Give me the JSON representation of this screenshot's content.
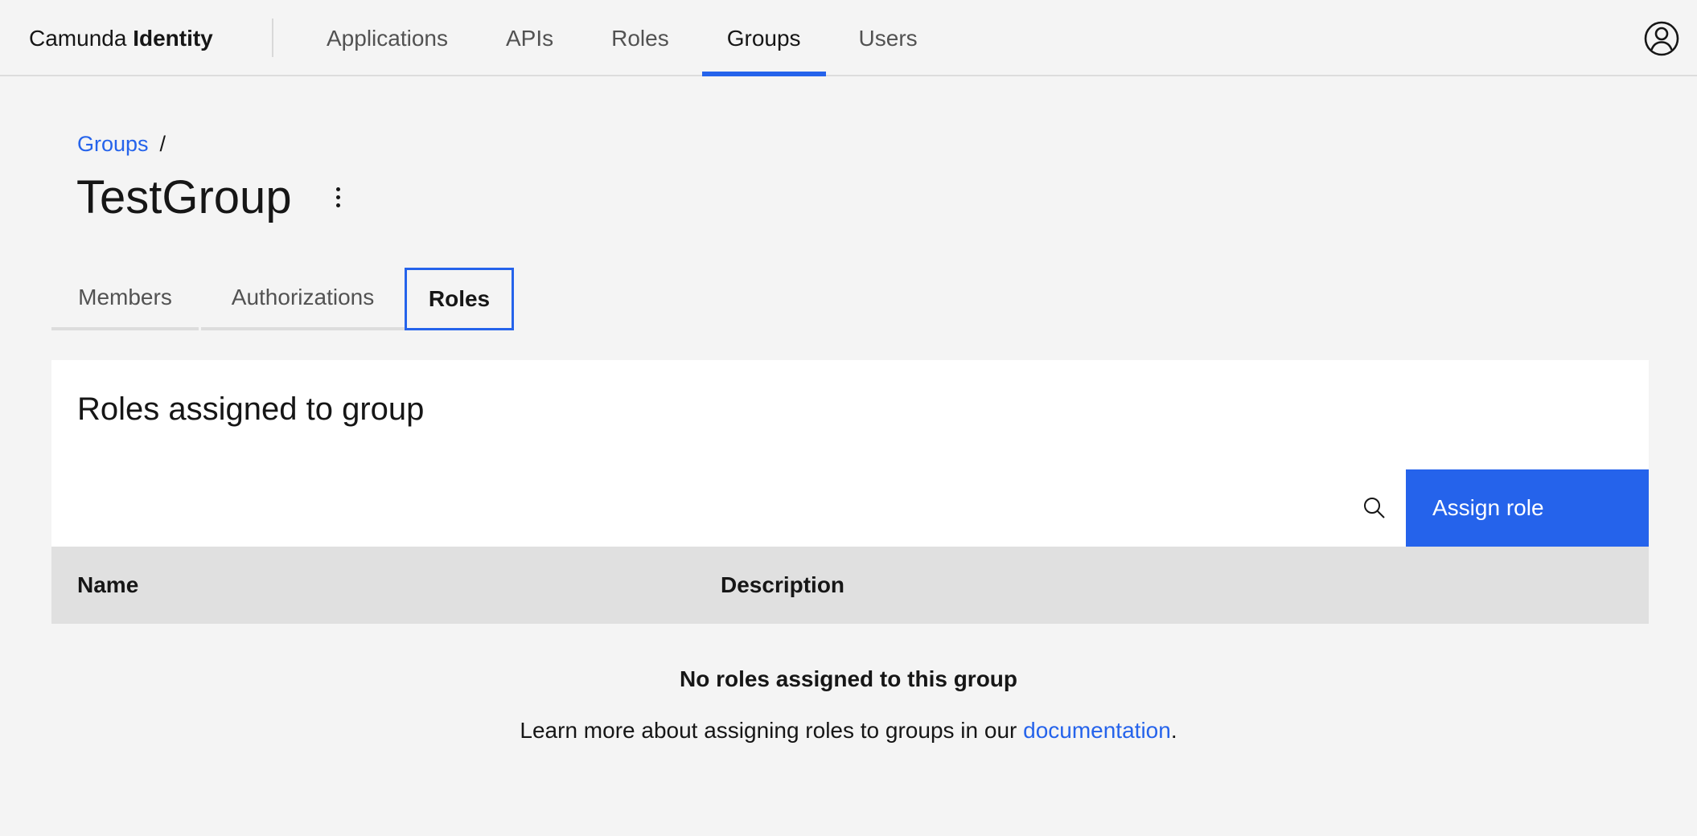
{
  "header": {
    "brand_light": "Camunda",
    "brand_strong": "Identity",
    "nav": [
      {
        "label": "Applications"
      },
      {
        "label": "APIs"
      },
      {
        "label": "Roles"
      },
      {
        "label": "Groups",
        "active": true
      },
      {
        "label": "Users"
      }
    ],
    "user_icon": "user-avatar-icon"
  },
  "breadcrumb": {
    "link": "Groups",
    "separator": "/"
  },
  "page": {
    "title": "TestGroup",
    "menu_icon": "overflow-menu-vertical-icon"
  },
  "tabs": [
    {
      "label": "Members"
    },
    {
      "label": "Authorizations"
    },
    {
      "label": "Roles",
      "active": true
    }
  ],
  "card": {
    "title": "Roles assigned to group",
    "search_icon": "search-icon",
    "assign_label": "Assign role"
  },
  "table": {
    "columns": [
      "Name",
      "Description"
    ]
  },
  "empty_state": {
    "title": "No roles assigned to this group",
    "text_before": "Learn more about assigning roles to groups in our ",
    "link": "documentation",
    "text_after": "."
  },
  "colors": {
    "accent": "#2563eb",
    "background": "#f4f4f4",
    "table_header": "#e0e0e0"
  }
}
